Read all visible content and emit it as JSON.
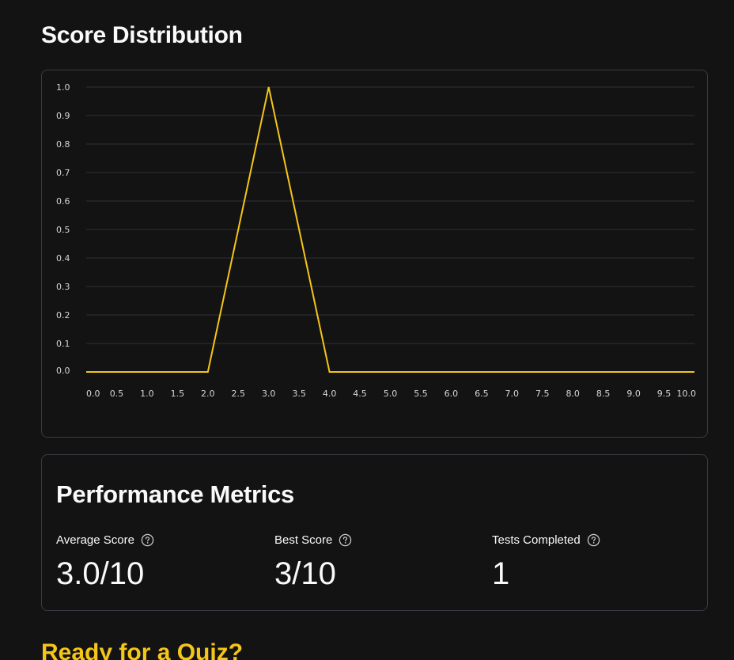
{
  "page": {
    "title": "Score Distribution",
    "next_heading": "Ready for a Quiz?"
  },
  "colors": {
    "background": "#131313",
    "line": "#f5c518",
    "grid": "#2f3035",
    "border": "#3a3b41",
    "heading_accent": "#f5c518"
  },
  "chart_data": {
    "type": "line",
    "title": "",
    "xlabel": "",
    "ylabel": "",
    "x": [
      0,
      1,
      2,
      3,
      4,
      5,
      6,
      7,
      8,
      9,
      10
    ],
    "series": [
      {
        "values": [
          0,
          0,
          0,
          1,
          0,
          0,
          0,
          0,
          0,
          0,
          0
        ]
      }
    ],
    "xlim": [
      0,
      10
    ],
    "ylim": [
      0,
      1
    ],
    "x_ticks": [
      "0.0",
      "0.5",
      "1.0",
      "1.5",
      "2.0",
      "2.5",
      "3.0",
      "3.5",
      "4.0",
      "4.5",
      "5.0",
      "5.5",
      "6.0",
      "6.5",
      "7.0",
      "7.5",
      "8.0",
      "8.5",
      "9.0",
      "9.5",
      "10.0"
    ],
    "y_ticks": [
      "0.0",
      "0.1",
      "0.2",
      "0.3",
      "0.4",
      "0.5",
      "0.6",
      "0.7",
      "0.8",
      "0.9",
      "1.0"
    ],
    "grid": true,
    "legend": "none"
  },
  "metrics": {
    "title": "Performance Metrics",
    "items": [
      {
        "label": "Average Score",
        "value": "3.0/10",
        "icon": "help-circle-icon"
      },
      {
        "label": "Best Score",
        "value": "3/10",
        "icon": "help-circle-icon"
      },
      {
        "label": "Tests Completed",
        "value": "1",
        "icon": "help-circle-icon"
      }
    ]
  }
}
